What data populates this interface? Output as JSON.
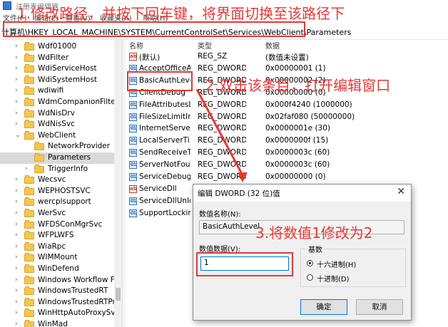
{
  "window": {
    "title": "注册表编辑器",
    "menu": [
      "文件(F)",
      "编辑(E)",
      "查看(V)",
      "收藏夹(A)",
      "帮助(H)"
    ]
  },
  "address": {
    "path": "计算机\\HKEY_LOCAL_MACHINE\\SYSTEM\\CurrentControlSet\\Services\\WebClient\\Parameters"
  },
  "tree": {
    "items": [
      {
        "label": "Wdf01000",
        "expandable": true
      },
      {
        "label": "WdFilter",
        "expandable": true
      },
      {
        "label": "WdiServiceHost",
        "expandable": true
      },
      {
        "label": "WdiSystemHost",
        "expandable": true
      },
      {
        "label": "wdiwifi",
        "expandable": true
      },
      {
        "label": "WdmCompanionFilter",
        "expandable": true
      },
      {
        "label": "WdNisDrv",
        "expandable": true
      },
      {
        "label": "WdNisSvc",
        "expandable": true
      },
      {
        "label": "WebClient",
        "expandable": true,
        "expanded": true
      },
      {
        "label": "NetworkProvider",
        "expandable": false,
        "child": true
      },
      {
        "label": "Parameters",
        "expandable": false,
        "child": true,
        "selected": true
      },
      {
        "label": "TriggerInfo",
        "expandable": true,
        "child": true
      },
      {
        "label": "Wecsvc",
        "expandable": true
      },
      {
        "label": "WEPHOSTSVC",
        "expandable": true
      },
      {
        "label": "wercplsupport",
        "expandable": true
      },
      {
        "label": "WerSvc",
        "expandable": true
      },
      {
        "label": "WFDSConMgrSvc",
        "expandable": true
      },
      {
        "label": "WFPLWFS",
        "expandable": true
      },
      {
        "label": "WiaRpc",
        "expandable": true
      },
      {
        "label": "WIMMount",
        "expandable": true
      },
      {
        "label": "WinDefend",
        "expandable": true
      },
      {
        "label": "Windows Workflow F",
        "expandable": true
      },
      {
        "label": "WindowsTrustedRT",
        "expandable": true
      },
      {
        "label": "WindowsTrustedRTPr",
        "expandable": true
      },
      {
        "label": "WinHttpAutoProxySvc",
        "expandable": true
      },
      {
        "label": "WinMad",
        "expandable": true
      }
    ]
  },
  "list": {
    "headers": {
      "name": "名称",
      "type": "类型",
      "data": "数据"
    },
    "rows": [
      {
        "icon": "ab",
        "name": "(默认)",
        "type": "REG_SZ",
        "data": "(数值未设置)"
      },
      {
        "icon": "bin",
        "name": "AcceptOfficeA...",
        "type": "REG_DWORD",
        "data": "0x00000001 (1)"
      },
      {
        "icon": "bin",
        "name": "BasicAuthLevel",
        "type": "REG_DWORD",
        "data": "0x00000002 (2)"
      },
      {
        "icon": "bin",
        "name": "ClientDebug",
        "type": "REG_DWORD",
        "data": "0x00000000 (0)"
      },
      {
        "icon": "bin",
        "name": "FileAttributesLi...",
        "type": "REG_DWORD",
        "data": "0x000f4240 (1000000)"
      },
      {
        "icon": "bin",
        "name": "FileSizeLimitIn...",
        "type": "REG_DWORD",
        "data": "0x02faf080 (50000000)"
      },
      {
        "icon": "bin",
        "name": "InternetServer...",
        "type": "REG_DWORD",
        "data": "0x0000001e (30)"
      },
      {
        "icon": "bin",
        "name": "LocalServerTi...",
        "type": "REG_DWORD",
        "data": "0x0000000f (15)"
      },
      {
        "icon": "bin",
        "name": "SendReceiveTi...",
        "type": "REG_DWORD",
        "data": "0x0000003c (60)"
      },
      {
        "icon": "bin",
        "name": "ServerNotFoun...",
        "type": "REG_DWORD",
        "data": "0x0000003c (60)"
      },
      {
        "icon": "bin",
        "name": "ServiceDebug",
        "type": "REG_DWORD",
        "data": "0x00000000 (0)"
      },
      {
        "icon": "ab",
        "name": "ServiceDll",
        "type": "",
        "data": ""
      },
      {
        "icon": "bin",
        "name": "ServiceDllUnlo...",
        "type": "",
        "data": ""
      },
      {
        "icon": "bin",
        "name": "SupportLocking",
        "type": "",
        "data": ""
      }
    ]
  },
  "annotations": {
    "step1": "1.修改路径，并按下回车键，将界面切换至该路径下",
    "step2": "2.双击该条目，打开编辑窗口",
    "step3": "3.将数值1修改为2",
    "color": "#e53935"
  },
  "dialog": {
    "title": "编辑 DWORD (32 位)值",
    "name_label": "数值名称(N):",
    "name_value": "BasicAuthLevel",
    "data_label": "数值数据(V):",
    "data_value": "1",
    "base_title": "基数",
    "base_options": [
      {
        "label": "十六进制(H)",
        "checked": true
      },
      {
        "label": "十进制(D)",
        "checked": false
      }
    ],
    "ok_label": "确定",
    "cancel_label": "取消"
  }
}
